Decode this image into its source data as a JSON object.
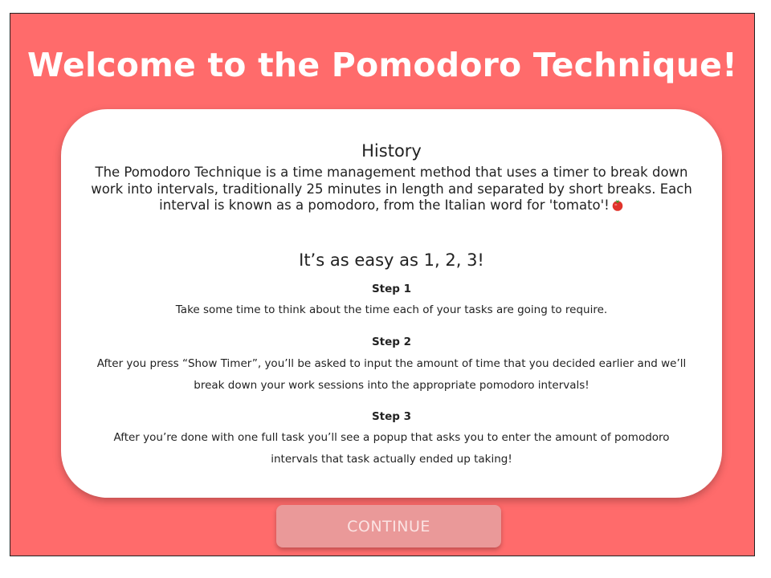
{
  "header": {
    "title": "Welcome to the Pomodoro Technique!"
  },
  "history": {
    "heading": "History",
    "text": "The Pomodoro Technique is a time management method that uses a timer to break down work into intervals, traditionally 25 minutes in length and separated by short breaks. Each interval is known as a pomodoro, from the Italian word for 'tomato'!",
    "emoji_icon": "tomato-icon"
  },
  "steps_section": {
    "heading": "It’s as easy as 1, 2, 3!",
    "steps": [
      {
        "title": "Step 1",
        "text": "Take some time to think about the time each of your tasks are going to require."
      },
      {
        "title": "Step 2",
        "text": "After you press “Show Timer”, you’ll be asked to input the amount of time that you decided earlier and we’ll break down your work sessions into the appropriate pomodoro intervals!"
      },
      {
        "title": "Step 3",
        "text": "After you’re done with one full task you’ll see a popup that asks you to enter the amount of pomodoro intervals that task actually ended up taking!"
      }
    ]
  },
  "actions": {
    "continue_label": "CONTINUE"
  },
  "colors": {
    "background": "#ff6b6b",
    "card": "#ffffff",
    "button": "#ea9999",
    "button_text": "#fbe3e3"
  }
}
